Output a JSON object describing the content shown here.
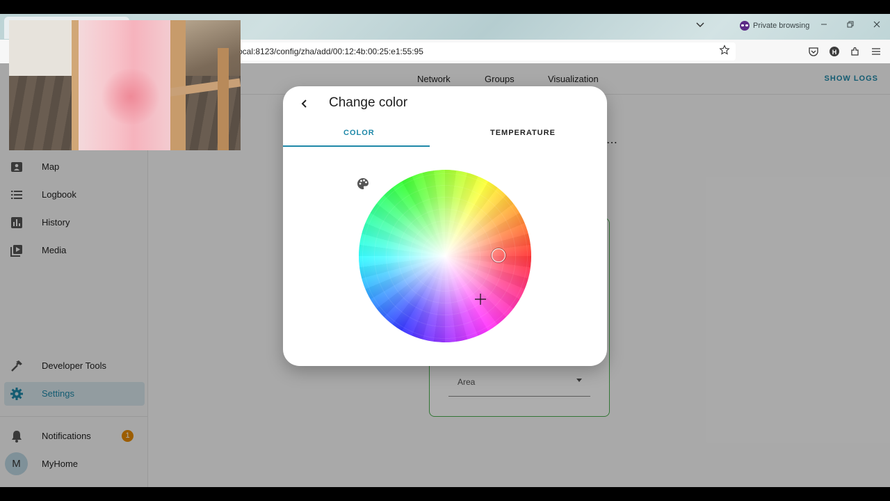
{
  "browser": {
    "private_label": "Private browsing",
    "url": "ocal:8123/config/zha/add/00:12:4b:00:25:e1:55:95"
  },
  "sidebar": {
    "items": [
      {
        "label": "Map",
        "icon": "map-icon"
      },
      {
        "label": "Logbook",
        "icon": "logbook-icon"
      },
      {
        "label": "History",
        "icon": "history-icon"
      },
      {
        "label": "Media",
        "icon": "media-icon"
      }
    ],
    "developer_tools": "Developer Tools",
    "settings": "Settings",
    "notifications": "Notifications",
    "notifications_count": "1",
    "user_initial": "M",
    "user_name": "MyHome"
  },
  "topbar": {
    "tabs": [
      "Network",
      "Groups",
      "Visualization"
    ],
    "show_logs": "SHOW LOGS"
  },
  "card": {
    "area_label": "Area"
  },
  "dialog": {
    "title": "Change color",
    "tab_color": "COLOR",
    "tab_temperature": "TEMPERATURE"
  },
  "colors": {
    "accent": "#1e88a8",
    "card_border": "#4caf50",
    "badge": "#e68a00"
  }
}
